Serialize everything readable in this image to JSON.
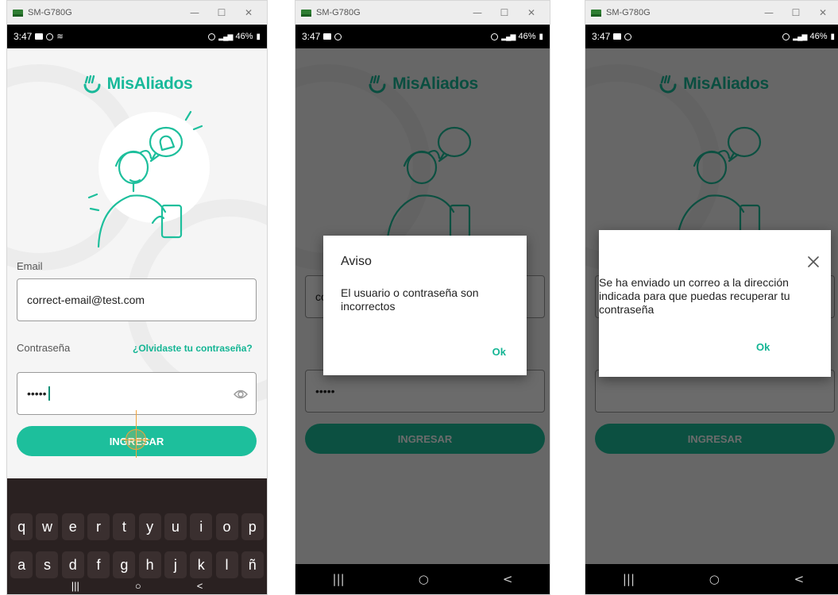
{
  "device_title": "SM-G780G",
  "window_controls": {
    "minimize": "—",
    "maximize": "☐",
    "close": "✕"
  },
  "status": {
    "time": "3:47",
    "battery": "46%",
    "signal": "Vo) LTE1"
  },
  "app": {
    "name": "MisAliados",
    "brand_color": "#19b99a"
  },
  "login": {
    "email_label": "Email",
    "email_value": "correct-email@test.com",
    "password_label": "Contraseña",
    "password_value": "•••••",
    "forgot_link": "¿Olvidaste tu contraseña?",
    "submit_label": "INGRESAR"
  },
  "keyboard": {
    "row1": [
      "q",
      "w",
      "e",
      "r",
      "t",
      "y",
      "u",
      "i",
      "o",
      "p"
    ],
    "row2": [
      "a",
      "s",
      "d",
      "f",
      "g",
      "h",
      "j",
      "k",
      "l",
      "ñ"
    ],
    "nav": {
      "recents": "|||",
      "home": "○",
      "back": "<"
    }
  },
  "dialog_error": {
    "title": "Aviso",
    "message": "El usuario o contraseña son incorrectos",
    "ok_label": "Ok"
  },
  "dialog_recovery": {
    "message": "Se ha enviado un correo a la dirección indicada para que puedas recuperar tu contraseña",
    "ok_label": "Ok",
    "close_icon": "close-icon"
  },
  "navbar": {
    "recents": "|||",
    "home": "○",
    "back": "<"
  }
}
